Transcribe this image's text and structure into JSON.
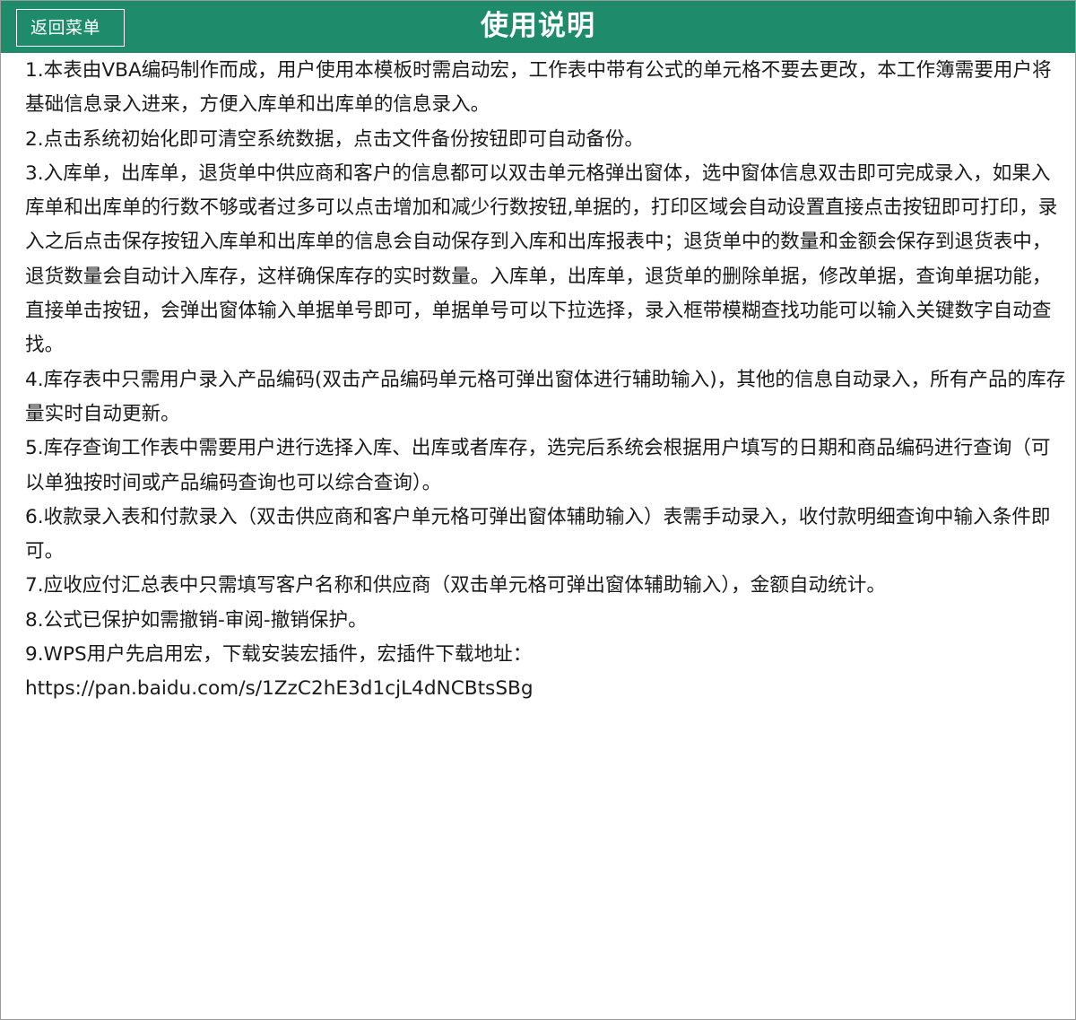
{
  "header": {
    "back_label": "返回菜单",
    "title": "使用说明",
    "background": "#1e8c6a"
  },
  "instructions": [
    "1.本表由VBA编码制作而成，用户使用本模板时需启动宏，工作表中带有公式的单元格不要去更改，本工作簿需要用户将基础信息录入进来，方便入库单和出库单的信息录入。",
    "2.点击系统初始化即可清空系统数据，点击文件备份按钮即可自动备份。",
    "3.入库单，出库单，退货单中供应商和客户的信息都可以双击单元格弹出窗体，选中窗体信息双击即可完成录入，如果入库单和出库单的行数不够或者过多可以点击增加和减少行数按钮,单据的，打印区域会自动设置直接点击按钮即可打印，录入之后点击保存按钮入库单和出库单的信息会自动保存到入库和出库报表中；退货单中的数量和金额会保存到退货表中，退货数量会自动计入库存，这样确保库存的实时数量。入库单，出库单，退货单的删除单据，修改单据，查询单据功能，直接单击按钮，会弹出窗体输入单据单号即可，单据单号可以下拉选择，录入框带模糊查找功能可以输入关键数字自动查找。",
    "4.库存表中只需用户录入产品编码(双击产品编码单元格可弹出窗体进行辅助输入)，其他的信息自动录入，所有产品的库存量实时自动更新。",
    "5.库存查询工作表中需要用户进行选择入库、出库或者库存，选完后系统会根据用户填写的日期和商品编码进行查询（可以单独按时间或产品编码查询也可以综合查询）。",
    "6.收款录入表和付款录入（双击供应商和客户单元格可弹出窗体辅助输入）表需手动录入，收付款明细查询中输入条件即可。",
    "7.应收应付汇总表中只需填写客户名称和供应商（双击单元格可弹出窗体辅助输入），金额自动统计。",
    "8.公式已保护如需撤销-审阅-撤销保护。",
    "9.WPS用户先启用宏，下载安装宏插件，宏插件下载地址："
  ],
  "download_url": "https://pan.baidu.com/s/1ZzC2hE3d1cjL4dNCBtsSBg"
}
